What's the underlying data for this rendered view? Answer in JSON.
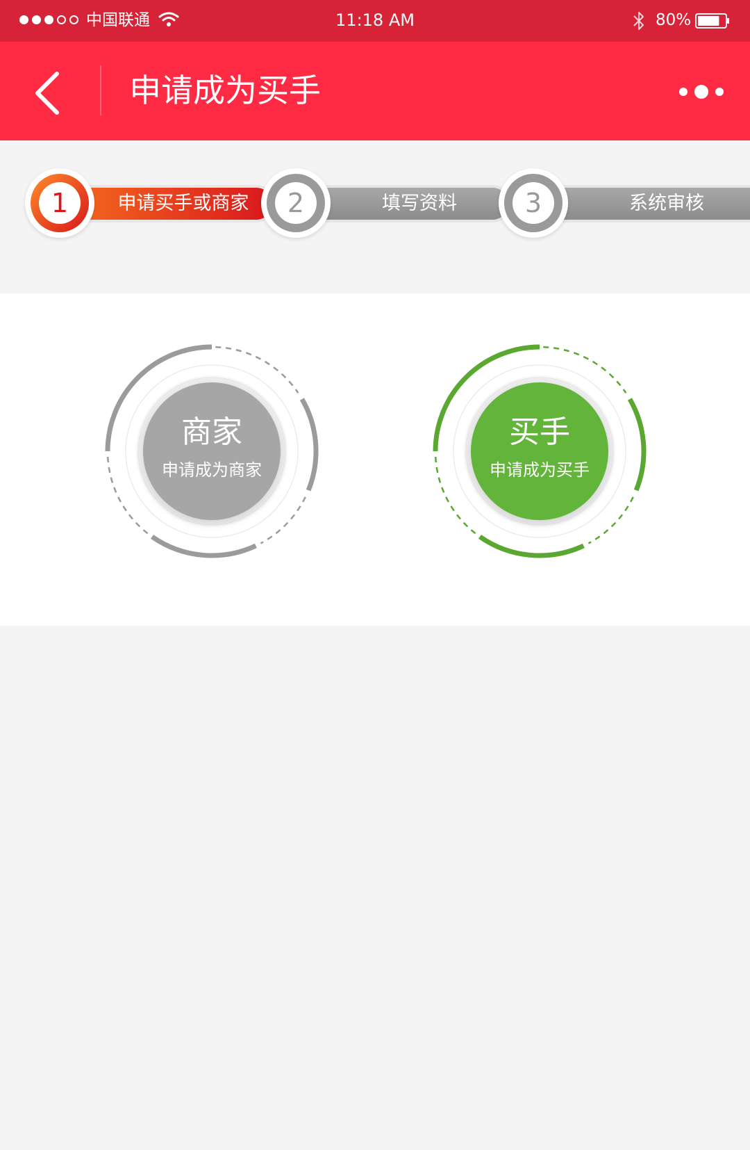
{
  "status_bar": {
    "carrier": "中国联通",
    "time": "11:18 AM",
    "battery": "80%",
    "battery_level": 0.8,
    "signal_bars_filled": 3,
    "signal_bars_total": 5,
    "icons": [
      "wifi-icon",
      "bluetooth-icon",
      "battery-icon"
    ]
  },
  "header": {
    "title": "申请成为买手",
    "back_icon": "chevron-left-icon",
    "more_icon": "more-dots-icon"
  },
  "steps": [
    {
      "number": "1",
      "label": "申请买手或商家",
      "state": "active"
    },
    {
      "number": "2",
      "label": "填写资料",
      "state": "inactive"
    },
    {
      "number": "3",
      "label": "系统审核",
      "state": "inactive"
    }
  ],
  "choices": [
    {
      "title": "商家",
      "subtitle": "申请成为商家",
      "color": "#a6a6a6",
      "ring_color": "#9b9b9b"
    },
    {
      "title": "买手",
      "subtitle": "申请成为买手",
      "color": "#63b43a",
      "ring_color": "#5aa832"
    }
  ],
  "colors": {
    "status_bar": "#d62337",
    "nav_bar": "#ff2b45",
    "step_active_start": "#f46a1e",
    "step_active_end": "#d9171d",
    "step_inactive": "#999999",
    "background": "#f4f4f4"
  }
}
